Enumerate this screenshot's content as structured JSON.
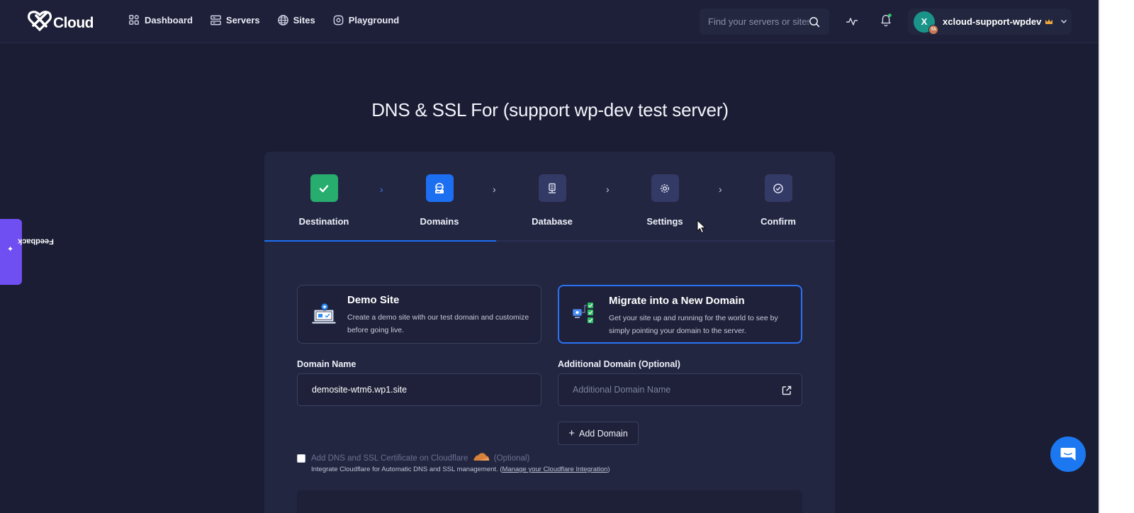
{
  "brand": {
    "logo_text": "Cloud"
  },
  "nav": {
    "items": [
      {
        "label": "Dashboard",
        "icon": "dashboard-icon"
      },
      {
        "label": "Servers",
        "icon": "servers-icon"
      },
      {
        "label": "Sites",
        "icon": "globe-icon"
      },
      {
        "label": "Playground",
        "icon": "playground-icon"
      }
    ],
    "search_placeholder": "Find your servers or sites",
    "user": {
      "avatar_initial": "X",
      "avatar_sub": "TA",
      "name": "xcloud-support-wpdev"
    }
  },
  "page": {
    "title": "DNS & SSL For (support wp-dev test server)"
  },
  "steps": [
    {
      "label": "Destination",
      "state": "completed",
      "color": "#27ae6e"
    },
    {
      "label": "Domains",
      "state": "current",
      "color": "#1d6ff2"
    },
    {
      "label": "Database",
      "state": "upcoming",
      "color": "#343a66"
    },
    {
      "label": "Settings",
      "state": "upcoming",
      "color": "#343a66"
    },
    {
      "label": "Confirm",
      "state": "upcoming",
      "color": "#343a66"
    }
  ],
  "options": {
    "demo": {
      "title": "Demo Site",
      "description": "Create a demo site with our test domain and customize before going live."
    },
    "migrate": {
      "title": "Migrate into a New Domain",
      "description": "Get your site up and running for the world to see by simply pointing your domain to the server."
    }
  },
  "form": {
    "domain_label": "Domain Name",
    "domain_value": "demosite-wtm6.wp1.site",
    "additional_label": "Additional Domain (Optional)",
    "additional_placeholder": "Additional Domain Name",
    "add_domain_button": "Add Domain",
    "cloudflare_label": "Add DNS and SSL Certificate on Cloudflare",
    "cloudflare_optional": "(Optional)",
    "cloudflare_sub": "Integrate Cloudflare for Automatic DNS and SSL management. (",
    "cloudflare_link": "Manage your Cloudflare Integration",
    "cloudflare_sub_end": ")"
  },
  "feedback": {
    "label": "Feedback"
  },
  "colors": {
    "accent": "#1d6ff2",
    "success": "#27ae6e",
    "background": "#1a1d34",
    "card": "#222641",
    "feedback": "#6f4ef2"
  }
}
